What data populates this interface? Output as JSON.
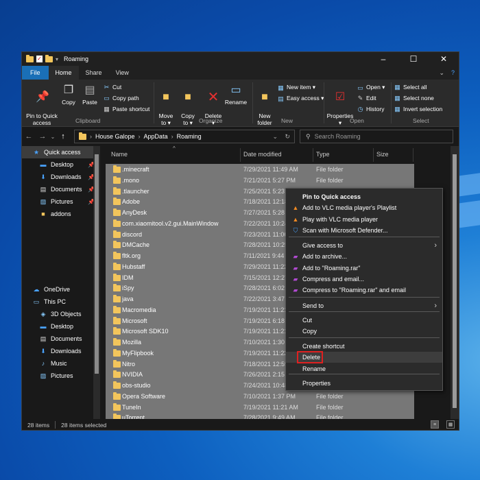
{
  "window": {
    "title": "Roaming",
    "controls": [
      "–",
      "☐",
      "✕"
    ]
  },
  "tabs": {
    "file": "File",
    "home": "Home",
    "share": "Share",
    "view": "View",
    "collapse": "⌄",
    "help": "?"
  },
  "ribbon": {
    "clipboard": {
      "label": "Clipboard",
      "pin": "Pin to Quick\naccess",
      "copy": "Copy",
      "paste": "Paste",
      "cut": "Cut",
      "copy_path": "Copy path",
      "paste_shortcut": "Paste shortcut"
    },
    "organize": {
      "label": "Organize",
      "move_to": "Move\nto ▾",
      "copy_to": "Copy\nto ▾",
      "delete": "Delete\n▾",
      "rename": "Rename"
    },
    "new": {
      "label": "New",
      "new_folder": "New\nfolder",
      "new_item": "New item ▾",
      "easy_access": "Easy access ▾"
    },
    "open": {
      "label": "Open",
      "properties": "Properties\n▾",
      "open": "Open ▾",
      "edit": "Edit",
      "history": "History"
    },
    "select": {
      "label": "Select",
      "select_all": "Select all",
      "select_none": "Select none",
      "invert": "Invert selection"
    }
  },
  "address": {
    "breadcrumb": [
      "House Galope",
      "AppData",
      "Roaming"
    ],
    "search_placeholder": "Search Roaming"
  },
  "columns": {
    "name": "Name",
    "date": "Date modified",
    "type": "Type",
    "size": "Size"
  },
  "sidebar": {
    "items": [
      {
        "label": "Quick access",
        "icon": "star-icon",
        "pinned": false,
        "selected": true
      },
      {
        "label": "Desktop",
        "icon": "desktop-icon",
        "pinned": true
      },
      {
        "label": "Downloads",
        "icon": "download-icon",
        "pinned": true
      },
      {
        "label": "Documents",
        "icon": "documents-icon",
        "pinned": true
      },
      {
        "label": "Pictures",
        "icon": "pictures-icon",
        "pinned": true
      },
      {
        "label": "addons",
        "icon": "folder-icon",
        "pinned": false
      },
      {
        "label": "OneDrive",
        "icon": "cloud-icon",
        "pinned": false
      },
      {
        "label": "This PC",
        "icon": "computer-icon",
        "pinned": false
      },
      {
        "label": "3D Objects",
        "icon": "cube-icon",
        "pinned": false
      },
      {
        "label": "Desktop",
        "icon": "desktop-icon",
        "pinned": false
      },
      {
        "label": "Documents",
        "icon": "documents-icon",
        "pinned": false
      },
      {
        "label": "Downloads",
        "icon": "download-icon",
        "pinned": false
      },
      {
        "label": "Music",
        "icon": "music-icon",
        "pinned": false
      },
      {
        "label": "Pictures",
        "icon": "pictures-icon",
        "pinned": false
      }
    ]
  },
  "files": [
    {
      "name": ".minecraft",
      "date": "7/29/2021 11:49 AM",
      "type": "File folder"
    },
    {
      "name": ".mono",
      "date": "7/21/2021 5:27 PM",
      "type": "File folder"
    },
    {
      "name": ".tlauncher",
      "date": "7/25/2021 5:23 P",
      "type": ""
    },
    {
      "name": "Adobe",
      "date": "7/18/2021 12:18",
      "type": ""
    },
    {
      "name": "AnyDesk",
      "date": "7/27/2021 5:28 P",
      "type": ""
    },
    {
      "name": "com.xiaomitool.v2.gui.MainWindow",
      "date": "7/22/2021 10:24",
      "type": ""
    },
    {
      "name": "discord",
      "date": "7/23/2021 11:06",
      "type": ""
    },
    {
      "name": "DMCache",
      "date": "7/28/2021 10:25",
      "type": ""
    },
    {
      "name": "fltk.org",
      "date": "7/11/2021 9:44 P",
      "type": ""
    },
    {
      "name": "Hubstaff",
      "date": "7/29/2021 11:22",
      "type": ""
    },
    {
      "name": "IDM",
      "date": "7/15/2021 12:27",
      "type": ""
    },
    {
      "name": "iSpy",
      "date": "7/28/2021 6:02 P",
      "type": ""
    },
    {
      "name": "java",
      "date": "7/22/2021 3:47 P",
      "type": ""
    },
    {
      "name": "Macromedia",
      "date": "7/19/2021 11:21",
      "type": ""
    },
    {
      "name": "Microsoft",
      "date": "7/19/2021 6:18 P",
      "type": ""
    },
    {
      "name": "Microsoft SDK10",
      "date": "7/19/2021 11:21",
      "type": ""
    },
    {
      "name": "Mozilla",
      "date": "7/10/2021 1:30 P",
      "type": ""
    },
    {
      "name": "MyFlipbook",
      "date": "7/19/2021 11:22",
      "type": ""
    },
    {
      "name": "Nitro",
      "date": "7/18/2021 12:59",
      "type": ""
    },
    {
      "name": "NVIDIA",
      "date": "7/26/2021 2:15 P",
      "type": ""
    },
    {
      "name": "obs-studio",
      "date": "7/24/2021 10:48",
      "type": ""
    },
    {
      "name": "Opera Software",
      "date": "7/10/2021 1:37 PM",
      "type": "File folder"
    },
    {
      "name": "TuneIn",
      "date": "7/19/2021 11:21 AM",
      "type": "File folder"
    },
    {
      "name": "uTorrent",
      "date": "7/28/2021 9:49 AM",
      "type": "File folder"
    }
  ],
  "context_menu": [
    {
      "label": "Pin to Quick access",
      "icon": "",
      "bold": true,
      "arrow": false
    },
    {
      "label": "Add to VLC media player's Playlist",
      "icon": "vlc-icon",
      "arrow": false
    },
    {
      "label": "Play with VLC media player",
      "icon": "vlc-icon",
      "arrow": false
    },
    {
      "label": "Scan with Microsoft Defender...",
      "icon": "defender-icon",
      "arrow": false
    },
    {
      "label": "Give access to",
      "icon": "",
      "arrow": true
    },
    {
      "label": "Add to archive...",
      "icon": "winrar-icon",
      "arrow": false
    },
    {
      "label": "Add to \"Roaming.rar\"",
      "icon": "winrar-icon",
      "arrow": false
    },
    {
      "label": "Compress and email...",
      "icon": "winrar-icon",
      "arrow": false
    },
    {
      "label": "Compress to \"Roaming.rar\" and email",
      "icon": "winrar-icon",
      "arrow": false
    },
    {
      "label": "Send to",
      "icon": "",
      "arrow": true
    },
    {
      "label": "Cut",
      "icon": "",
      "arrow": false
    },
    {
      "label": "Copy",
      "icon": "",
      "arrow": false
    },
    {
      "label": "Create shortcut",
      "icon": "",
      "arrow": false
    },
    {
      "label": "Delete",
      "icon": "",
      "arrow": false,
      "highlighted": true
    },
    {
      "label": "Rename",
      "icon": "",
      "arrow": false
    },
    {
      "label": "Properties",
      "icon": "",
      "arrow": false
    }
  ],
  "status": {
    "items": "28 items",
    "selected": "28 items selected"
  },
  "colors": {
    "selection_row": "#777777",
    "highlight_box": "#e02020",
    "folder": "#f2c55c",
    "file_tab": "#1a6fb7"
  }
}
